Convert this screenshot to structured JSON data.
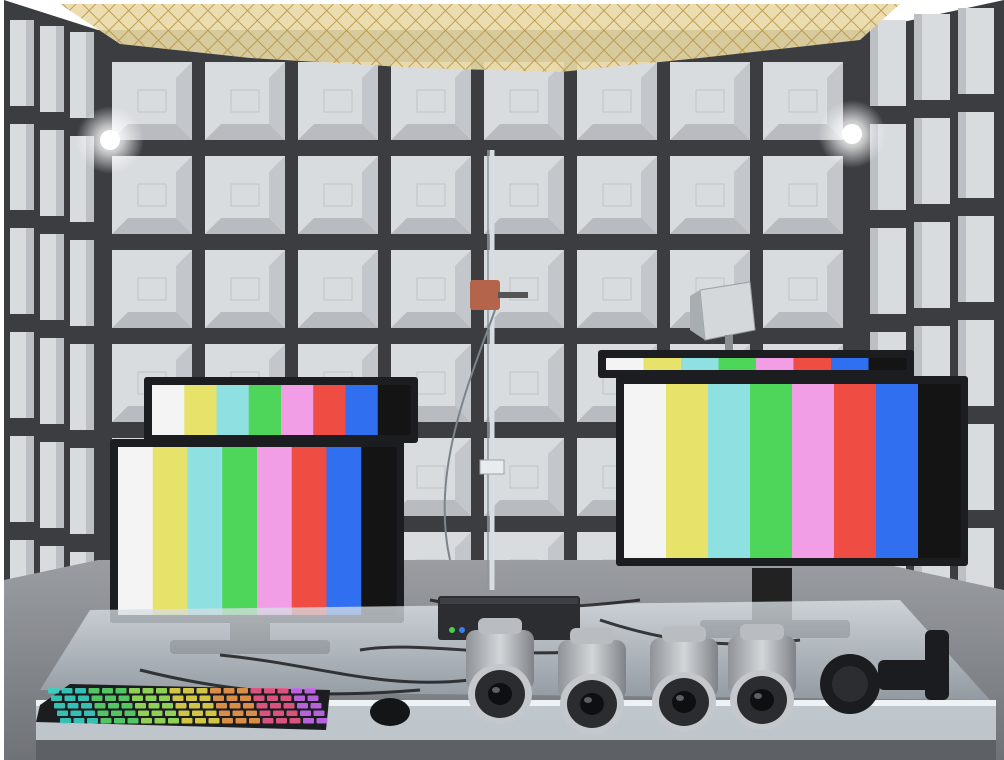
{
  "image": {
    "kind": "photograph",
    "subject": "anechoic-test-chamber",
    "colors": {
      "absorber": "#d9dcdf",
      "absorber_shadow": "#a9aeb4",
      "grid_frame": "#3b3d41",
      "net": "#c9a24a",
      "table_glass": "#cfd6dc",
      "camera_body": "#b9bcc0",
      "camera_lens": "#2a2c30",
      "monitor_bezel": "#1c1d20",
      "floor": "#8c8f93"
    },
    "color_bars": [
      "#f4f4f4",
      "#e7e36a",
      "#8fe0e0",
      "#4ed65a",
      "#f19ee6",
      "#ef4c44",
      "#2f6ff0",
      "#141414"
    ],
    "objects": [
      {
        "name": "monitor-left-back",
        "type": "monitor"
      },
      {
        "name": "monitor-left-front",
        "type": "monitor"
      },
      {
        "name": "monitor-right-back",
        "type": "monitor"
      },
      {
        "name": "monitor-right-front",
        "type": "monitor"
      },
      {
        "name": "keyboard",
        "type": "keyboard"
      },
      {
        "name": "mouse",
        "type": "mouse"
      },
      {
        "name": "network-switch",
        "type": "device"
      },
      {
        "name": "bullet-camera",
        "type": "camera",
        "count": 4
      },
      {
        "name": "dome-camera-mount",
        "type": "camera"
      },
      {
        "name": "antenna-mast",
        "type": "antenna"
      },
      {
        "name": "horn-antenna",
        "type": "antenna"
      },
      {
        "name": "ceiling-net",
        "type": "net"
      },
      {
        "name": "lights",
        "type": "light",
        "count": 2
      }
    ]
  }
}
